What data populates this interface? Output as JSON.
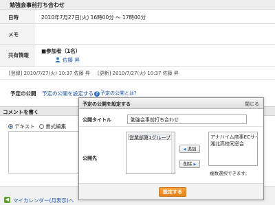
{
  "event": {
    "title": "勉強会事前打ち合わせ"
  },
  "detail": {
    "date_label": "日時",
    "date_value": "2010年7月27日(火) 16時00分 ～ 17時00分",
    "memo_label": "メモ",
    "share_label": "共有情報",
    "participants_heading": "■参加者（1名）",
    "participants": [
      "佐藤 昇"
    ],
    "registered": "[登録] 2010/7/27(火) 10:37 佐藤 昇",
    "updated": "[更新] 2010/7/27(火) 10:37 佐藤 昇"
  },
  "publish": {
    "label": "予定の公開",
    "set_link": "予定の公開を設定する",
    "help_link": "予定の公開とは?",
    "help_icon": "question-icon"
  },
  "comment": {
    "header": "コメントを書く",
    "option_text": "テキスト",
    "option_rich": "書式編集",
    "selected": "テキスト"
  },
  "footer": {
    "link": "マイカレンダー(月表示)へ",
    "arrow_icon": "arrow-left-icon"
  },
  "dialog": {
    "title": "予定の公開を設定する",
    "close": "閉じる",
    "title_label": "公開タイトル",
    "title_value": "勉強会事前打ち合わせ",
    "target_label": "公開先",
    "available": [
      "営業部第1グループ"
    ],
    "add_button": "追加",
    "remove_button": "削除",
    "selected_targets": [
      "アナハイム商事ECサイ",
      "湘北高校同窓会"
    ],
    "multi_note": "複数選択できます。",
    "submit": "設定する",
    "accent_color": "#e9801b"
  }
}
